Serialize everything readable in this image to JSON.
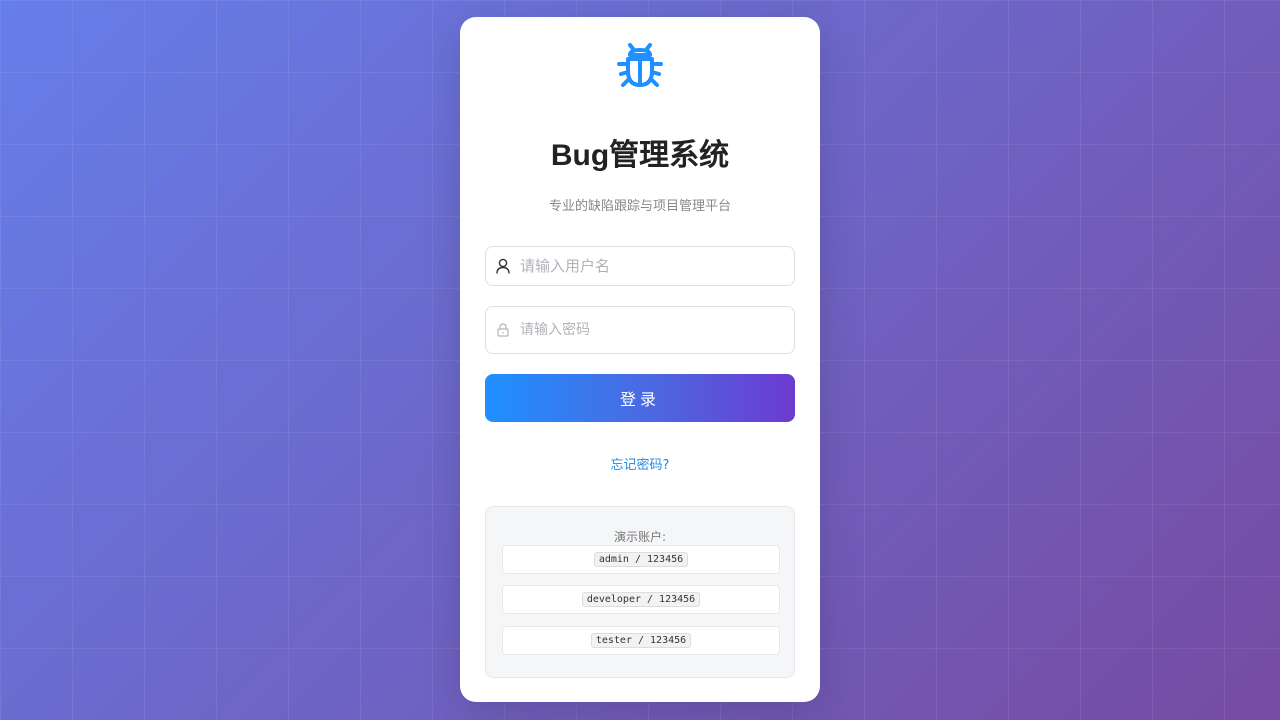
{
  "app": {
    "title": "Bug管理系统",
    "subtitle": "专业的缺陷跟踪与项目管理平台",
    "logo_icon": "bug-icon"
  },
  "form": {
    "username_placeholder": "请输入用户名",
    "password_placeholder": "请输入密码",
    "username_icon": "user-icon",
    "password_icon": "lock-icon",
    "login_label": "登录",
    "forgot_label": "忘记密码?"
  },
  "demo": {
    "title": "演示账户:",
    "accounts": [
      "admin / 123456",
      "developer / 123456",
      "tester / 123456"
    ]
  },
  "colors": {
    "bg_start": "#667eea",
    "bg_end": "#764ba2",
    "accent": "#1e90ff",
    "button_end": "#6c3bd0",
    "link": "#1e88e5"
  }
}
